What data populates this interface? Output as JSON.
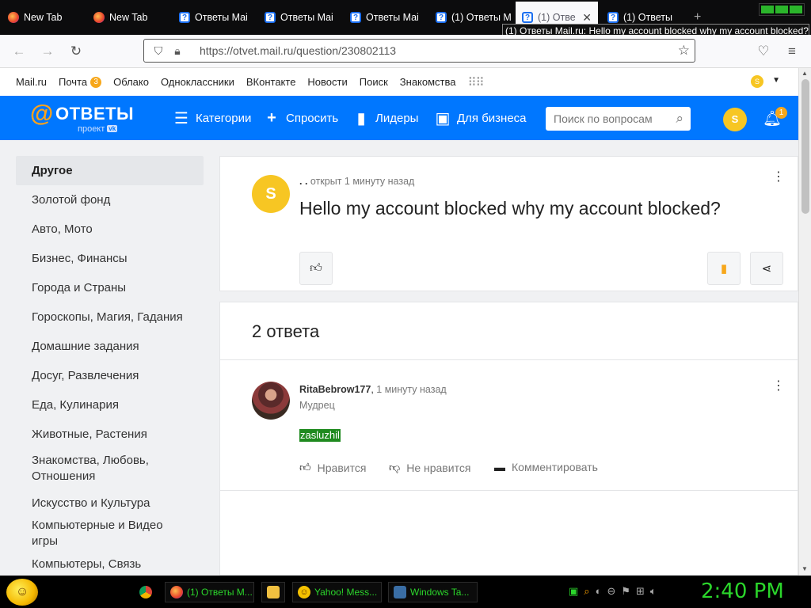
{
  "browser": {
    "tabs": [
      {
        "title": "New Tab",
        "icon": "firefox-icon"
      },
      {
        "title": "New Tab",
        "icon": "firefox-icon"
      },
      {
        "title": "Ответы Mai",
        "icon": "otvety-icon"
      },
      {
        "title": "Ответы Mai",
        "icon": "otvety-icon"
      },
      {
        "title": "Ответы Mai",
        "icon": "otvety-icon"
      },
      {
        "title": "(1) Ответы M",
        "icon": "otvety-icon"
      },
      {
        "title": "(1) Отве",
        "icon": "otvety-icon",
        "active": true
      },
      {
        "title": "(1) Ответы",
        "icon": "otvety-icon"
      }
    ],
    "new_tab_glyph": "+",
    "close_glyph": "✕",
    "tooltip": "(1) Ответы Mail.ru: Hello my account blocked why my account blocked?",
    "url": "https://otvet.mail.ru/question/230802113"
  },
  "mailbar": {
    "links": [
      "Mail.ru",
      "Почта",
      "Облако",
      "Одноклассники",
      "ВКонтакте",
      "Новости",
      "Поиск",
      "Знакомства"
    ],
    "pochta_badge": "3",
    "avatar_letter": "S"
  },
  "header": {
    "logo_at": "@",
    "logo_name": "ОТВЕТЫ",
    "logo_sub": "проект",
    "logo_vk": "vk",
    "nav": {
      "categories": "Категории",
      "ask": "Спросить",
      "leaders": "Лидеры",
      "business": "Для бизнеса"
    },
    "search_placeholder": "Поиск по вопросам",
    "avatar_letter": "S",
    "bell_badge": "1"
  },
  "sidebar": {
    "items": [
      "Другое",
      "Золотой фонд",
      "Авто, Мото",
      "Бизнес, Финансы",
      "Города и Страны",
      "Гороскопы, Магия, Гадания",
      "Домашние задания",
      "Досуг, Развлечения",
      "Еда, Кулинария",
      "Животные, Растения",
      "Знакомства, Любовь, Отношения",
      "Искусство и Культура",
      "Компьютерные и Видео игры",
      "Компьютеры, Связь"
    ]
  },
  "question": {
    "avatar_letter": "S",
    "author": ". .",
    "meta": "открыт 1 минуту назад",
    "title": "Hello my account blocked why my account blocked?"
  },
  "answers": {
    "count_label": "2 ответа",
    "items": [
      {
        "user": "RitaBebrow177",
        "time": "1 минуту назад",
        "rank": "Мудрец",
        "text": "zasluzhil",
        "like_label": "Нравится",
        "dislike_label": "Не нравится",
        "comment_label": "Комментировать"
      }
    ]
  },
  "taskbar": {
    "buttons": [
      {
        "label": "",
        "icon": "chrome-icon"
      },
      {
        "label": "(1) Ответы M...",
        "icon": "firefox-icon"
      },
      {
        "label": "",
        "icon": "folder-icon"
      },
      {
        "label": "Yahoo! Mess...",
        "icon": "yahoo-messenger-icon"
      },
      {
        "label": "Windows Ta...",
        "icon": "task-manager-icon"
      }
    ],
    "clock": "2:40 PM"
  },
  "colors": {
    "brand_blue": "#0077ff",
    "accent_orange": "#f7a71b",
    "avatar_yellow": "#f7c623",
    "taskbar_green": "#2bd62b"
  }
}
